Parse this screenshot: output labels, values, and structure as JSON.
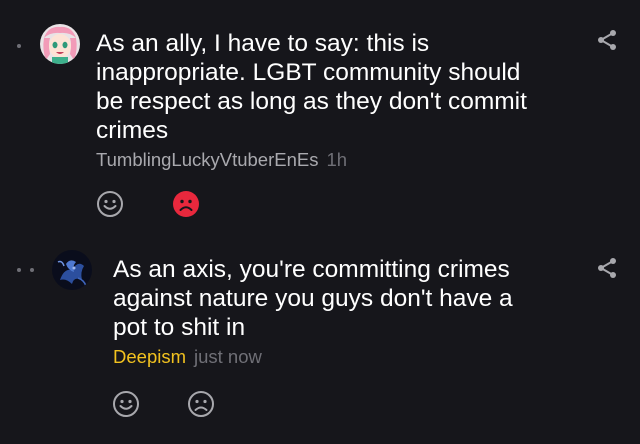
{
  "comments": [
    {
      "text": "As an ally, I have to say: this is inappropriate. LGBT community should be respect as long as they don't commit crimes",
      "author": "TumblingLuckyVtuberEnEs",
      "time": "1h",
      "author_color": "#a9a9ae",
      "reactions": [
        "smile-icon",
        "frown-icon-active"
      ],
      "thread_depth": 1
    },
    {
      "text": "As an axis, you're committing crimes against nature you guys don't have a pot to shit in",
      "author": "Deepism",
      "time": "just now",
      "author_color": "#f2c21f",
      "reactions": [
        "smile-icon",
        "frown-icon"
      ],
      "thread_depth": 2
    }
  ],
  "colors": {
    "background": "#16161b",
    "text": "#ffffff",
    "muted": "#6f6f76",
    "dislike_active": "#e8283d",
    "icon": "#a8a8ad"
  }
}
